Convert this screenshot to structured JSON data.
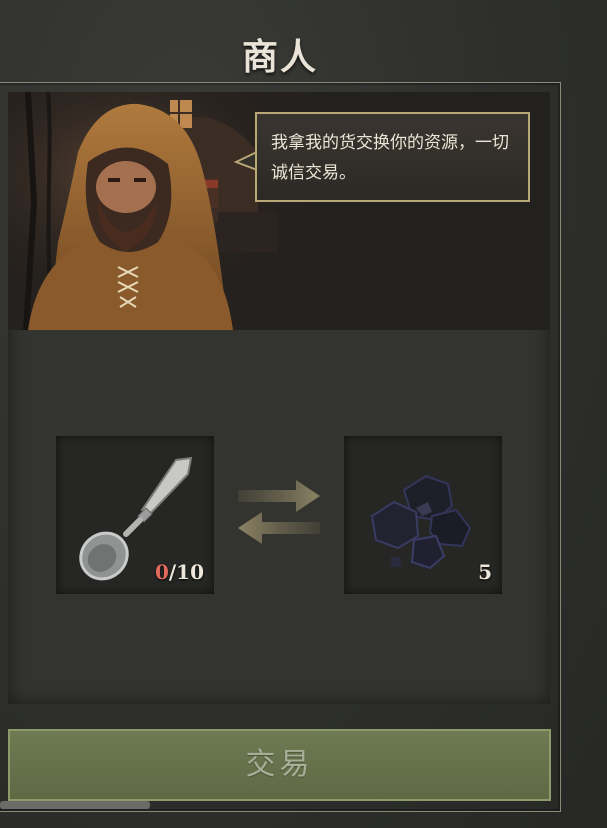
{
  "header": {
    "title": "商人"
  },
  "merchant": {
    "speech": "我拿我的货交换你的资源，一切诚信交易。"
  },
  "trade": {
    "give": {
      "icon": "spoon-icon",
      "have": "0",
      "need": "/10"
    },
    "get": {
      "icon": "coal-icon",
      "amount": "5"
    },
    "swap_icon": "swap-arrows-icon",
    "button_label": "交易"
  },
  "colors": {
    "button_bg": "#66714b",
    "have_insufficient": "#e06a5c",
    "speech_border": "#b8a777"
  }
}
